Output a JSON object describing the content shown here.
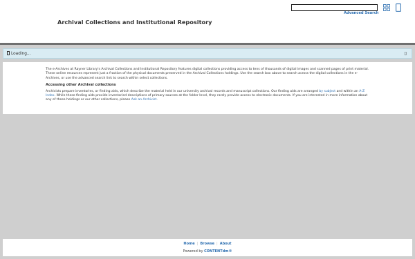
{
  "header": {
    "title": "Archival Collections and Institutional Repository",
    "search_value": "",
    "advanced_search_label": "Advanced Search",
    "grid_icon": "grid-icon",
    "save_icon": "bookmark-icon"
  },
  "status": {
    "loading_text": "Loading...",
    "refresh_icon": "refresh-icon"
  },
  "main": {
    "intro": "The e-Archives at Rayner Library's Archival Collections and Institutional Repository features digital collections providing access to tens of thousands of digital images and scanned pages of print material.  These online resources represent just a fraction of the physical documents preserved in the Archival Collections holdings. Use the search box above to search across the digital collections in the e-Archives, or use the advanced search link to search within select collections.",
    "heading": "Accessing other Archival collections",
    "para2_a": "Archivists prepare inventories, or finding aids, which describe the material held in our university archival records and manuscript collections. Our finding aids are arranged ",
    "link_by_subject": "by subject",
    "para2_b": " and within an ",
    "link_az": "A-Z Index",
    "para2_c": ".  While these finding aids provide inventoried descriptions of primary sources at the folder level, they rarely provide access to electronic documents.  If you are interested in more information about any of these holdings or our other collections, please ",
    "link_ask": "Ask an Archivist",
    "para2_d": "."
  },
  "footer": {
    "nav": [
      "Home",
      "Browse",
      "About"
    ],
    "powered_prefix": "Powered by ",
    "powered_brand": "CONTENTdm®"
  },
  "colors": {
    "link": "#2a6db0",
    "loading_bg": "#d9ecf3",
    "page_bg": "#cfcfcf"
  }
}
